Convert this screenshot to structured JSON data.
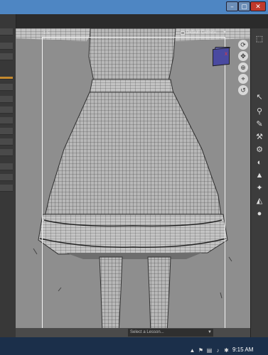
{
  "window": {
    "min": "–",
    "max": "▢",
    "close": "✕"
  },
  "viewport": {
    "camera": "Default Camera",
    "frame_label": "1:5",
    "cube_axis": "X"
  },
  "nav_icons": [
    "rotate-icon",
    "pan-icon",
    "zoom-icon",
    "frame-icon",
    "fit-icon",
    "reset-icon"
  ],
  "right_icons": [
    "pointer-icon",
    "move-icon",
    "joint-icon",
    "brush-icon",
    "region-icon",
    "scale-icon",
    "material-icon",
    "surface-icon",
    "light-icon",
    "morph-icon",
    "sphere-icon"
  ],
  "status": {
    "lesson": "Select a Lesson..."
  },
  "taskbar": {
    "time": "9:15 AM"
  },
  "colors": {
    "titlebar": "#4e86c3",
    "viewport": "#8e8e8e",
    "accent": "#c58a2e"
  }
}
